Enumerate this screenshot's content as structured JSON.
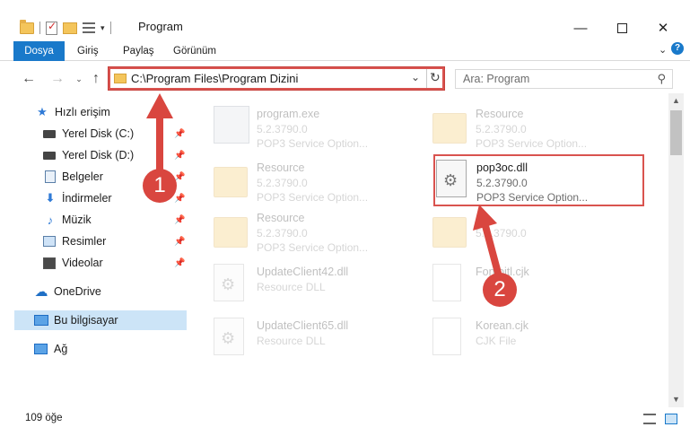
{
  "window": {
    "title": "Program",
    "minimize_glyph": "—",
    "close_glyph": "✕"
  },
  "ribbon": {
    "tabs": [
      "Dosya",
      "Giriş",
      "Paylaş",
      "Görünüm"
    ],
    "help_glyph": "?"
  },
  "nav": {
    "back_glyph": "←",
    "forward_glyph": "→",
    "recent_glyph": "⌄",
    "up_glyph": "↑",
    "address": "C:\\Program Files\\Program Dizini",
    "search_placeholder": "Ara: Program"
  },
  "sidebar": {
    "items": [
      {
        "label": "Hızlı erişim",
        "icon": "star-icon"
      },
      {
        "label": "Yerel Disk (C:)",
        "icon": "drive-icon",
        "pinned": true
      },
      {
        "label": "Yerel Disk (D:)",
        "icon": "drive-icon",
        "pinned": true
      },
      {
        "label": "Belgeler",
        "icon": "documents-icon",
        "pinned": true
      },
      {
        "label": "İndirmeler",
        "icon": "download-icon",
        "pinned": true
      },
      {
        "label": "Müzik",
        "icon": "music-icon",
        "pinned": true
      },
      {
        "label": "Resimler",
        "icon": "pictures-icon",
        "pinned": true
      },
      {
        "label": "Videolar",
        "icon": "videos-icon",
        "pinned": true
      },
      {
        "label": "OneDrive",
        "icon": "cloud-icon"
      },
      {
        "label": "Bu bilgisayar",
        "icon": "computer-icon",
        "selected": true
      },
      {
        "label": "Ağ",
        "icon": "network-icon"
      }
    ]
  },
  "files": [
    {
      "name": "program.exe",
      "line2": "5.2.3790.0",
      "line3": "POP3 Service Option...",
      "type": "exe",
      "faded": true
    },
    {
      "name": "Resource",
      "line2": "5.2.3790.0",
      "line3": "POP3 Service Option...",
      "type": "folder",
      "faded": true
    },
    {
      "name": "Resource",
      "line2": "5.2.3790.0",
      "line3": "POP3 Service Option...",
      "type": "folder",
      "faded": true
    },
    {
      "name": "pop3oc.dll",
      "line2": "5.2.3790.0",
      "line3": "POP3 Service Option...",
      "type": "dll",
      "faded": false
    },
    {
      "name": "Resource",
      "line2": "5.2.3790.0",
      "line3": "POP3 Service Option...",
      "type": "folder",
      "faded": true
    },
    {
      "name": "",
      "line2": "5.2.3790.0",
      "line3": "",
      "type": "folder",
      "faded": true
    },
    {
      "name": "UpdateClient42.dll",
      "line2": "Resource DLL",
      "line3": "",
      "type": "dll",
      "faded": true
    },
    {
      "name": "Fontbitl.cjk",
      "line2": "",
      "line3": "",
      "type": "cjk",
      "faded": true
    },
    {
      "name": "UpdateClient65.dll",
      "line2": "Resource DLL",
      "line3": "",
      "type": "dll",
      "faded": true
    },
    {
      "name": "Korean.cjk",
      "line2": "CJK File",
      "line3": "",
      "type": "cjk",
      "faded": true
    }
  ],
  "status": {
    "item_count": "109 öğe"
  },
  "annotations": {
    "step1": "1",
    "step2": "2",
    "color": "#d9463f"
  }
}
